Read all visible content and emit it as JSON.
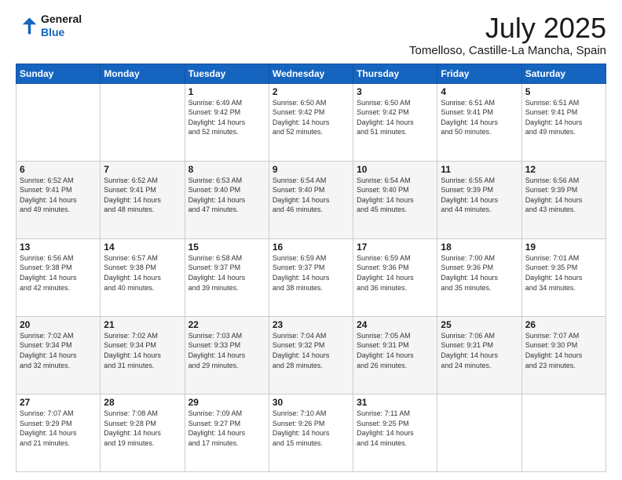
{
  "header": {
    "logo_line1": "General",
    "logo_line2": "Blue",
    "month_year": "July 2025",
    "location": "Tomelloso, Castille-La Mancha, Spain"
  },
  "weekdays": [
    "Sunday",
    "Monday",
    "Tuesday",
    "Wednesday",
    "Thursday",
    "Friday",
    "Saturday"
  ],
  "weeks": [
    [
      {
        "day": "",
        "info": ""
      },
      {
        "day": "",
        "info": ""
      },
      {
        "day": "1",
        "info": "Sunrise: 6:49 AM\nSunset: 9:42 PM\nDaylight: 14 hours\nand 52 minutes."
      },
      {
        "day": "2",
        "info": "Sunrise: 6:50 AM\nSunset: 9:42 PM\nDaylight: 14 hours\nand 52 minutes."
      },
      {
        "day": "3",
        "info": "Sunrise: 6:50 AM\nSunset: 9:42 PM\nDaylight: 14 hours\nand 51 minutes."
      },
      {
        "day": "4",
        "info": "Sunrise: 6:51 AM\nSunset: 9:41 PM\nDaylight: 14 hours\nand 50 minutes."
      },
      {
        "day": "5",
        "info": "Sunrise: 6:51 AM\nSunset: 9:41 PM\nDaylight: 14 hours\nand 49 minutes."
      }
    ],
    [
      {
        "day": "6",
        "info": "Sunrise: 6:52 AM\nSunset: 9:41 PM\nDaylight: 14 hours\nand 49 minutes."
      },
      {
        "day": "7",
        "info": "Sunrise: 6:52 AM\nSunset: 9:41 PM\nDaylight: 14 hours\nand 48 minutes."
      },
      {
        "day": "8",
        "info": "Sunrise: 6:53 AM\nSunset: 9:40 PM\nDaylight: 14 hours\nand 47 minutes."
      },
      {
        "day": "9",
        "info": "Sunrise: 6:54 AM\nSunset: 9:40 PM\nDaylight: 14 hours\nand 46 minutes."
      },
      {
        "day": "10",
        "info": "Sunrise: 6:54 AM\nSunset: 9:40 PM\nDaylight: 14 hours\nand 45 minutes."
      },
      {
        "day": "11",
        "info": "Sunrise: 6:55 AM\nSunset: 9:39 PM\nDaylight: 14 hours\nand 44 minutes."
      },
      {
        "day": "12",
        "info": "Sunrise: 6:56 AM\nSunset: 9:39 PM\nDaylight: 14 hours\nand 43 minutes."
      }
    ],
    [
      {
        "day": "13",
        "info": "Sunrise: 6:56 AM\nSunset: 9:38 PM\nDaylight: 14 hours\nand 42 minutes."
      },
      {
        "day": "14",
        "info": "Sunrise: 6:57 AM\nSunset: 9:38 PM\nDaylight: 14 hours\nand 40 minutes."
      },
      {
        "day": "15",
        "info": "Sunrise: 6:58 AM\nSunset: 9:37 PM\nDaylight: 14 hours\nand 39 minutes."
      },
      {
        "day": "16",
        "info": "Sunrise: 6:59 AM\nSunset: 9:37 PM\nDaylight: 14 hours\nand 38 minutes."
      },
      {
        "day": "17",
        "info": "Sunrise: 6:59 AM\nSunset: 9:36 PM\nDaylight: 14 hours\nand 36 minutes."
      },
      {
        "day": "18",
        "info": "Sunrise: 7:00 AM\nSunset: 9:36 PM\nDaylight: 14 hours\nand 35 minutes."
      },
      {
        "day": "19",
        "info": "Sunrise: 7:01 AM\nSunset: 9:35 PM\nDaylight: 14 hours\nand 34 minutes."
      }
    ],
    [
      {
        "day": "20",
        "info": "Sunrise: 7:02 AM\nSunset: 9:34 PM\nDaylight: 14 hours\nand 32 minutes."
      },
      {
        "day": "21",
        "info": "Sunrise: 7:02 AM\nSunset: 9:34 PM\nDaylight: 14 hours\nand 31 minutes."
      },
      {
        "day": "22",
        "info": "Sunrise: 7:03 AM\nSunset: 9:33 PM\nDaylight: 14 hours\nand 29 minutes."
      },
      {
        "day": "23",
        "info": "Sunrise: 7:04 AM\nSunset: 9:32 PM\nDaylight: 14 hours\nand 28 minutes."
      },
      {
        "day": "24",
        "info": "Sunrise: 7:05 AM\nSunset: 9:31 PM\nDaylight: 14 hours\nand 26 minutes."
      },
      {
        "day": "25",
        "info": "Sunrise: 7:06 AM\nSunset: 9:31 PM\nDaylight: 14 hours\nand 24 minutes."
      },
      {
        "day": "26",
        "info": "Sunrise: 7:07 AM\nSunset: 9:30 PM\nDaylight: 14 hours\nand 23 minutes."
      }
    ],
    [
      {
        "day": "27",
        "info": "Sunrise: 7:07 AM\nSunset: 9:29 PM\nDaylight: 14 hours\nand 21 minutes."
      },
      {
        "day": "28",
        "info": "Sunrise: 7:08 AM\nSunset: 9:28 PM\nDaylight: 14 hours\nand 19 minutes."
      },
      {
        "day": "29",
        "info": "Sunrise: 7:09 AM\nSunset: 9:27 PM\nDaylight: 14 hours\nand 17 minutes."
      },
      {
        "day": "30",
        "info": "Sunrise: 7:10 AM\nSunset: 9:26 PM\nDaylight: 14 hours\nand 15 minutes."
      },
      {
        "day": "31",
        "info": "Sunrise: 7:11 AM\nSunset: 9:25 PM\nDaylight: 14 hours\nand 14 minutes."
      },
      {
        "day": "",
        "info": ""
      },
      {
        "day": "",
        "info": ""
      }
    ]
  ]
}
